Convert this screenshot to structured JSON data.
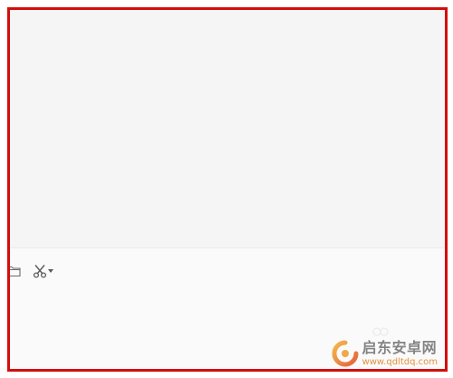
{
  "window": {
    "highlight_color": "#d40d0d"
  },
  "chat_area": {
    "background": "#f5f5f5"
  },
  "toolbar": {
    "items": [
      {
        "icon": "folder-icon"
      },
      {
        "icon": "scissors-icon"
      }
    ]
  },
  "watermark": {
    "title": "启东安卓网",
    "url": "www.qdltdq.com",
    "accent": "#e08a2d"
  }
}
